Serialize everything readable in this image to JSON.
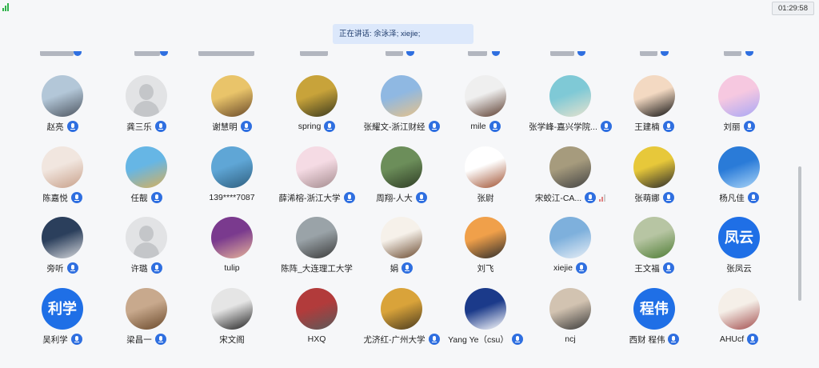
{
  "timer": "01:29:58",
  "speaking": {
    "label": "正在讲话: 余泳泽; xiejie;"
  },
  "participants": [
    {
      "name": "赵亮",
      "avatar": "photo",
      "colors": [
        "#b3c7d8",
        "#4d5560"
      ],
      "mic": "on"
    },
    {
      "name": "龚三乐",
      "avatar": "placeholder",
      "mic": "on"
    },
    {
      "name": "谢慧明",
      "avatar": "photo",
      "colors": [
        "#e9c46a",
        "#6a4a2a"
      ],
      "mic": "on"
    },
    {
      "name": "spring",
      "avatar": "photo",
      "colors": [
        "#c8a33a",
        "#3b3a1d"
      ],
      "mic": "on"
    },
    {
      "name": "张耀文-浙江财经",
      "avatar": "photo",
      "colors": [
        "#8fb8e2",
        "#e6c28a"
      ],
      "mic": "on"
    },
    {
      "name": "mile",
      "avatar": "photo",
      "colors": [
        "#efefef",
        "#5b3c2e"
      ],
      "mic": "on"
    },
    {
      "name": "张学峰-嘉兴学院...",
      "avatar": "photo",
      "colors": [
        "#7fc9d6",
        "#e6e2ce"
      ],
      "mic": "on"
    },
    {
      "name": "王建楠",
      "avatar": "photo",
      "colors": [
        "#f3d9c2",
        "#111111"
      ],
      "mic": "on"
    },
    {
      "name": "刘丽",
      "avatar": "photo",
      "colors": [
        "#f6c8e0",
        "#a9a7f5"
      ],
      "mic": "on"
    },
    {
      "name": "陈嘉悦",
      "avatar": "photo",
      "colors": [
        "#f1e6df",
        "#c8a08a"
      ],
      "mic": "on"
    },
    {
      "name": "任靓",
      "avatar": "photo",
      "colors": [
        "#66b6e5",
        "#d7b05b"
      ],
      "mic": "on"
    },
    {
      "name": "139****7087",
      "avatar": "photo",
      "colors": [
        "#5fa6d6",
        "#2f5f7f"
      ],
      "mic": "none"
    },
    {
      "name": "薛浠榕-浙江大学",
      "avatar": "photo",
      "colors": [
        "#f5dbe4",
        "#a48b8e"
      ],
      "mic": "on"
    },
    {
      "name": "周翔-人大",
      "avatar": "photo",
      "colors": [
        "#6c8e5a",
        "#2f3d25"
      ],
      "mic": "on"
    },
    {
      "name": "张尉",
      "avatar": "photo",
      "colors": [
        "#ffffff",
        "#a05030"
      ],
      "mic": "none"
    },
    {
      "name": "宋蛟江-CA...",
      "avatar": "photo",
      "colors": [
        "#a69b7d",
        "#444444"
      ],
      "mic": "on",
      "bars": true
    },
    {
      "name": "张萌娜",
      "avatar": "photo",
      "colors": [
        "#e7c83a",
        "#2b2b2b"
      ],
      "mic": "on"
    },
    {
      "name": "杨凡佳",
      "avatar": "photo",
      "colors": [
        "#2a7bd8",
        "#a9d4f7"
      ],
      "mic": "on"
    },
    {
      "name": "旁听",
      "avatar": "photo",
      "colors": [
        "#2b3f5c",
        "#d5d7db"
      ],
      "mic": "on"
    },
    {
      "name": "许璐",
      "avatar": "placeholder",
      "mic": "on"
    },
    {
      "name": "tulip",
      "avatar": "photo",
      "colors": [
        "#7a3a8e",
        "#e6b39a"
      ],
      "mic": "none"
    },
    {
      "name": "陈阵_大连理工大学",
      "avatar": "photo",
      "colors": [
        "#9aa3a8",
        "#3a3a3a"
      ],
      "mic": "none"
    },
    {
      "name": "娟",
      "avatar": "photo",
      "colors": [
        "#f6f1ea",
        "#6b4a2f"
      ],
      "mic": "on"
    },
    {
      "name": "刘飞",
      "avatar": "photo",
      "colors": [
        "#f0a04a",
        "#2c2c2c"
      ],
      "mic": "none"
    },
    {
      "name": "xiejie",
      "avatar": "photo",
      "colors": [
        "#7eb0dc",
        "#e7eef6"
      ],
      "mic": "on"
    },
    {
      "name": "王文福",
      "avatar": "photo",
      "colors": [
        "#b7c5a3",
        "#4f7d35"
      ],
      "mic": "on"
    },
    {
      "name": "张凤云",
      "avatar": "text",
      "text": "凤云",
      "mic": "none"
    },
    {
      "name": "吴利学",
      "avatar": "text",
      "text": "利学",
      "mic": "on"
    },
    {
      "name": "梁昌一",
      "avatar": "photo",
      "colors": [
        "#c8a98d",
        "#6b4a2c"
      ],
      "mic": "on"
    },
    {
      "name": "宋文阁",
      "avatar": "photo",
      "colors": [
        "#e5e5e5",
        "#222222"
      ],
      "mic": "none"
    },
    {
      "name": "HXQ",
      "avatar": "photo",
      "colors": [
        "#b23b3b",
        "#5a5a5a"
      ],
      "mic": "none"
    },
    {
      "name": "尤济红-广州大学",
      "avatar": "photo",
      "colors": [
        "#d9a33a",
        "#4a3b1f"
      ],
      "mic": "on"
    },
    {
      "name": "Yang Ye（csu）",
      "avatar": "photo",
      "colors": [
        "#1b3a8a",
        "#ffffff"
      ],
      "mic": "on"
    },
    {
      "name": "ncj",
      "avatar": "photo",
      "colors": [
        "#d2c3b1",
        "#3a3a3a"
      ],
      "mic": "none"
    },
    {
      "name": "西财 程伟",
      "avatar": "text",
      "text": "程伟",
      "mic": "on"
    },
    {
      "name": "AHUcf",
      "avatar": "photo",
      "colors": [
        "#f5efe8",
        "#a34e4e"
      ],
      "mic": "on"
    }
  ]
}
